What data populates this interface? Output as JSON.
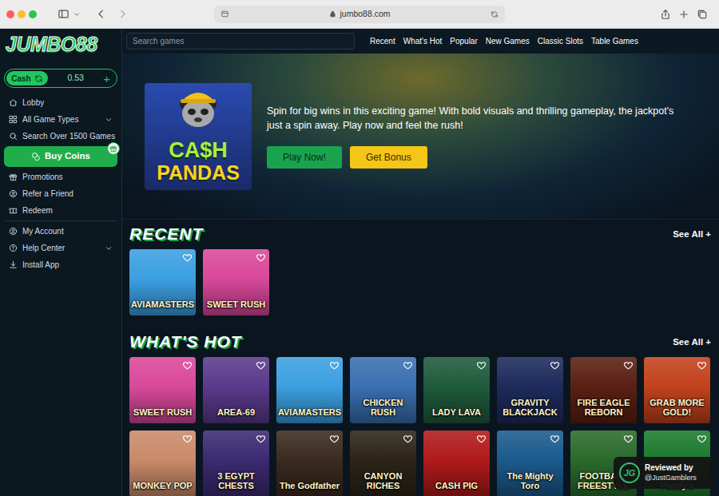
{
  "browser": {
    "url": "jumbo88.com"
  },
  "sidebar": {
    "logo": "JUMBO88",
    "wallet": {
      "mode": "Cash",
      "balance": "0.53",
      "add": "+"
    },
    "groups": [
      {
        "items": [
          {
            "label": "Lobby",
            "kind": "link"
          },
          {
            "label": "All Game Types",
            "kind": "menu",
            "expanded": false
          },
          {
            "label": "Search Over 1500 Games",
            "kind": "link"
          },
          {
            "label": "Buy Coins",
            "kind": "button"
          },
          {
            "label": "Promotions",
            "kind": "link"
          },
          {
            "label": "Refer a Friend",
            "kind": "link"
          },
          {
            "label": "Redeem",
            "kind": "link"
          }
        ]
      },
      {
        "items": [
          {
            "label": "My Account",
            "kind": "link"
          },
          {
            "label": "Help Center",
            "kind": "menu",
            "expanded": false
          },
          {
            "label": "Install App",
            "kind": "link"
          }
        ]
      }
    ]
  },
  "topbar": {
    "search_placeholder": "Search games",
    "links": [
      "Recent",
      "What's Hot",
      "Popular",
      "New Games",
      "Classic Slots",
      "Table Games"
    ]
  },
  "hero": {
    "art_lines": [
      "CA$H",
      "PANDAS"
    ],
    "text": "Spin for big wins in this exciting game! With bold visuals and thrilling gameplay, the jackpot's just a spin away. Play now and feel the rush!",
    "buttons": [
      "Play Now!",
      "Get Bonus"
    ]
  },
  "sections": [
    {
      "title": "RECENT",
      "see_all": "See All +",
      "games": [
        {
          "title": "AVIAMASTERS",
          "color": "#3b9fe0",
          "favorite": false
        },
        {
          "title": "SWEET RUSH",
          "color": "#d9489a",
          "favorite": false
        }
      ]
    },
    {
      "title": "WHAT'S HOT",
      "see_all": "See All +",
      "games": [
        {
          "title": "SWEET RUSH",
          "color": "#d9489a",
          "favorite": false
        },
        {
          "title": "AREA-69",
          "color": "#5a3a8c",
          "favorite": false
        },
        {
          "title": "AVIAMASTERS",
          "color": "#3b9fe0",
          "favorite": false
        },
        {
          "title": "CHICKEN RUSH",
          "color": "#3a6fb0",
          "favorite": false
        },
        {
          "title": "LADY LAVA",
          "color": "#1f5a3c",
          "favorite": false
        },
        {
          "title": "GRAVITY BLACKJACK",
          "color": "#1d2b5c",
          "favorite": false
        },
        {
          "title": "FIRE EAGLE REBORN",
          "color": "#5a1f12",
          "favorite": false
        },
        {
          "title": "GRAB MORE GOLD!",
          "color": "#c2421c",
          "favorite": false
        },
        {
          "title": "MONKEY POP",
          "color": "#c98a6a",
          "favorite": false
        },
        {
          "title": "3 EGYPT CHESTS",
          "color": "#3b2a72",
          "favorite": false
        },
        {
          "title": "The Godfather",
          "color": "#3a2a20",
          "favorite": false
        },
        {
          "title": "CANYON RICHES",
          "color": "#2c2418",
          "favorite": false
        },
        {
          "title": "CASH PIG",
          "color": "#b01a1a",
          "favorite": false
        },
        {
          "title": "The Mighty Toro",
          "color": "#1b5a8c",
          "favorite": false
        },
        {
          "title": "FOOTBALL FREESTYLE",
          "color": "#2a6a2c",
          "favorite": false
        },
        {
          "title": "Paddy's",
          "color": "#1a7a2c",
          "favorite": false
        }
      ]
    }
  ],
  "badge": {
    "logo": "JG",
    "line1": "Reviewed by",
    "line2": "@JustGamblers"
  }
}
